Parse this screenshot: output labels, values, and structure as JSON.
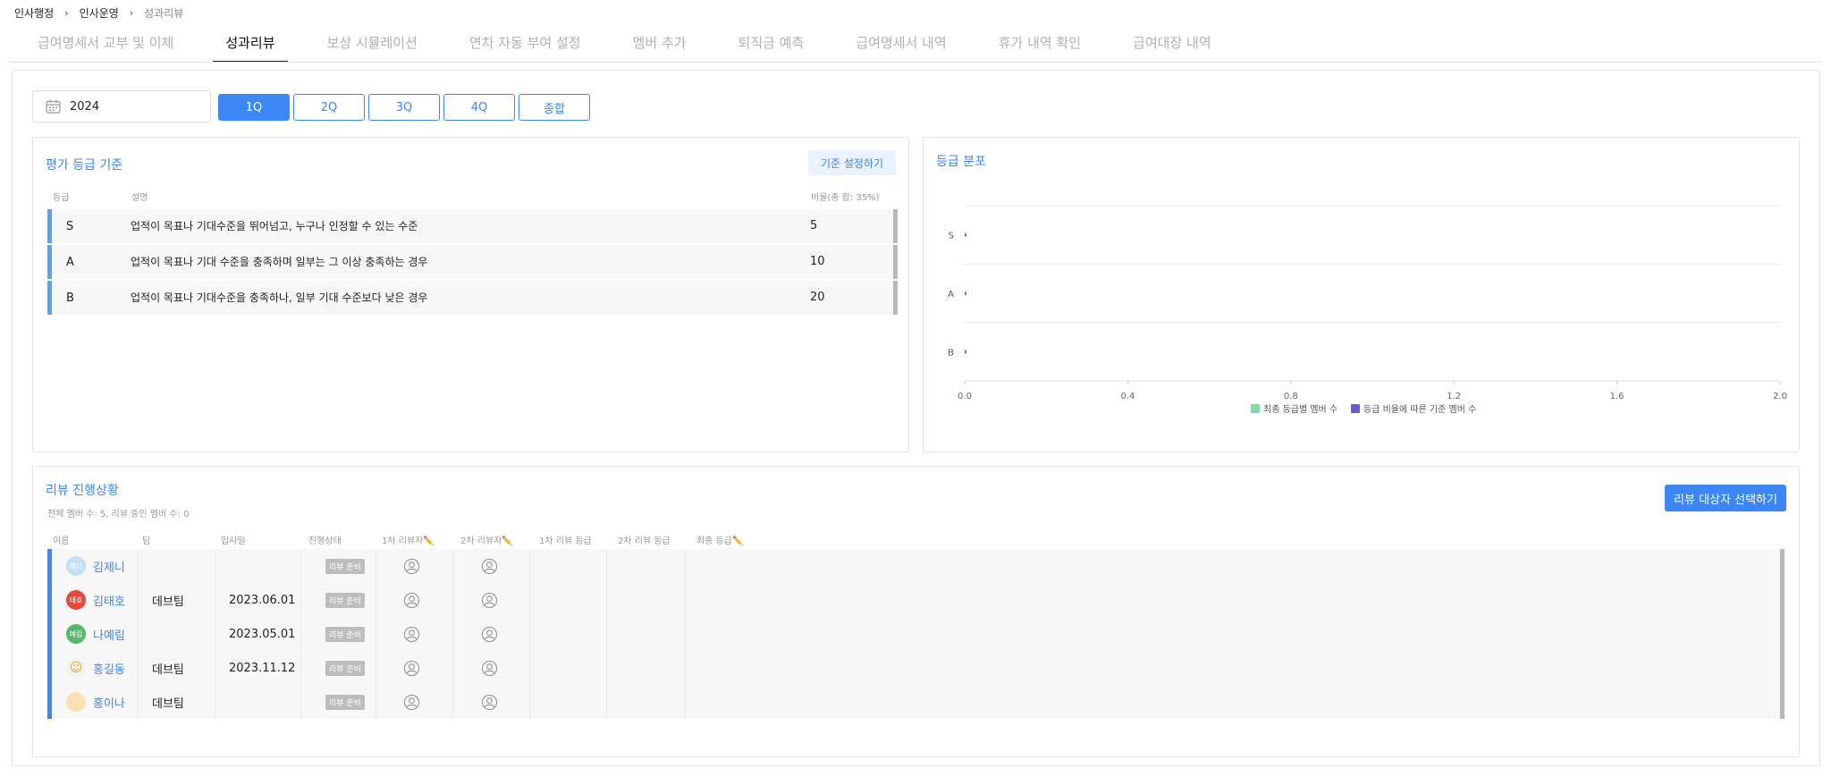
{
  "breadcrumb": [
    "인사행정",
    "인사운영",
    "성과리뷰"
  ],
  "tabs": [
    {
      "label": "급여명세서 교부 및 이체",
      "active": false
    },
    {
      "label": "성과리뷰",
      "active": true
    },
    {
      "label": "보상 시뮬레이션",
      "active": false
    },
    {
      "label": "연차 자동 부여 설정",
      "active": false
    },
    {
      "label": "멤버 추가",
      "active": false
    },
    {
      "label": "퇴직금 예측",
      "active": false
    },
    {
      "label": "급여명세서 내역",
      "active": false
    },
    {
      "label": "휴가 내역 확인",
      "active": false
    },
    {
      "label": "급여대장 내역",
      "active": false
    }
  ],
  "year": "2024",
  "quarters": [
    {
      "label": "1Q",
      "active": true
    },
    {
      "label": "2Q",
      "active": false
    },
    {
      "label": "3Q",
      "active": false
    },
    {
      "label": "4Q",
      "active": false
    },
    {
      "label": "종합",
      "active": false
    }
  ],
  "criteria": {
    "title": "평가 등급 기준",
    "settings_label": "기준 설정하기",
    "headers": {
      "grade": "등급",
      "description": "설명",
      "ratio": "비율(총 합: 35%)"
    },
    "rows": [
      {
        "grade": "S",
        "description": "업적이 목표나 기대수준을 뛰어넘고, 누구나 인정할 수 있는 수준",
        "ratio": "5"
      },
      {
        "grade": "A",
        "description": "업적이 목표나 기대 수준을 충족하며 일부는 그 이상 충족하는 경우",
        "ratio": "10"
      },
      {
        "grade": "B",
        "description": "업적이 목표나 기대수준을 충족하나, 일부 기대 수준보다 낮은 경우",
        "ratio": "20"
      }
    ]
  },
  "distribution": {
    "title": "등급 분포"
  },
  "chart_data": {
    "type": "bar",
    "orientation": "horizontal",
    "categories": [
      "S",
      "A",
      "B"
    ],
    "series": [
      {
        "name": "최종 등급별 멤버 수",
        "values": [
          0,
          0,
          0
        ],
        "color": "#7fdba7"
      },
      {
        "name": "등급 비율에 따른 기준 멤버 수",
        "values": [
          0,
          0,
          0
        ],
        "color": "#6a5acd"
      }
    ],
    "xlim": [
      0,
      2.0
    ],
    "x_ticks": [
      "0.0",
      "0.4",
      "0.8",
      "1.2",
      "1.6",
      "2.0"
    ],
    "grid": true,
    "legend": "bottom"
  },
  "review": {
    "title": "리뷰 진행상황",
    "subtitle": "전체 멤버 수: 5, 리뷰 중인 멤버 수: 0",
    "select_label": "리뷰 대상자 선택하기",
    "headers": {
      "name": "이름",
      "team": "팀",
      "join_date": "입사일",
      "status": "진행상태",
      "reviewer1": "1차 리뷰자✏️",
      "reviewer2": "2차 리뷰자✏️",
      "grade1": "1차 리뷰 등급",
      "grade2": "2차 리뷰 등급",
      "final": "최종 등급✏️"
    },
    "rows": [
      {
        "name": "김제니",
        "avatar_text": "제니",
        "avatar_color": "#bfe0f7",
        "team": "",
        "join_date": "",
        "status": "리뷰 준비"
      },
      {
        "name": "김태호",
        "avatar_text": "태호",
        "avatar_color": "#e8473b",
        "team": "데브팀",
        "join_date": "2023.06.01",
        "status": "리뷰 준비"
      },
      {
        "name": "나예림",
        "avatar_text": "예림",
        "avatar_color": "#55b86c",
        "team": "",
        "join_date": "2023.05.01",
        "status": "리뷰 준비"
      },
      {
        "name": "홍길동",
        "avatar_text": "",
        "avatar_color": "#f3f3f3",
        "team": "데브팀",
        "join_date": "2023.11.12",
        "status": "리뷰 준비"
      },
      {
        "name": "홍이나",
        "avatar_text": "",
        "avatar_color": "#fbe0b5",
        "team": "데브팀",
        "join_date": "",
        "status": "리뷰 준비"
      }
    ]
  }
}
